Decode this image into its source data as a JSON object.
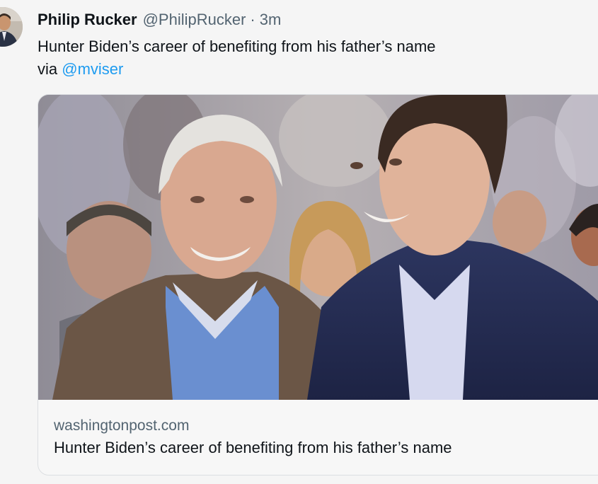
{
  "author": {
    "display_name": "Philip Rucker",
    "handle": "@PhilipRucker",
    "separator": "·",
    "time": "3m"
  },
  "tweet": {
    "text_line1": "Hunter Biden’s career of benefiting from his father’s name",
    "text_via": "via",
    "mention": "@mviser"
  },
  "card": {
    "domain": "washingtonpost.com",
    "title": "Hunter Biden’s career of benefiting from his father’s name"
  },
  "colors": {
    "link": "#1d9bf0",
    "secondary_text": "#536471",
    "primary_text": "#0f1419"
  }
}
